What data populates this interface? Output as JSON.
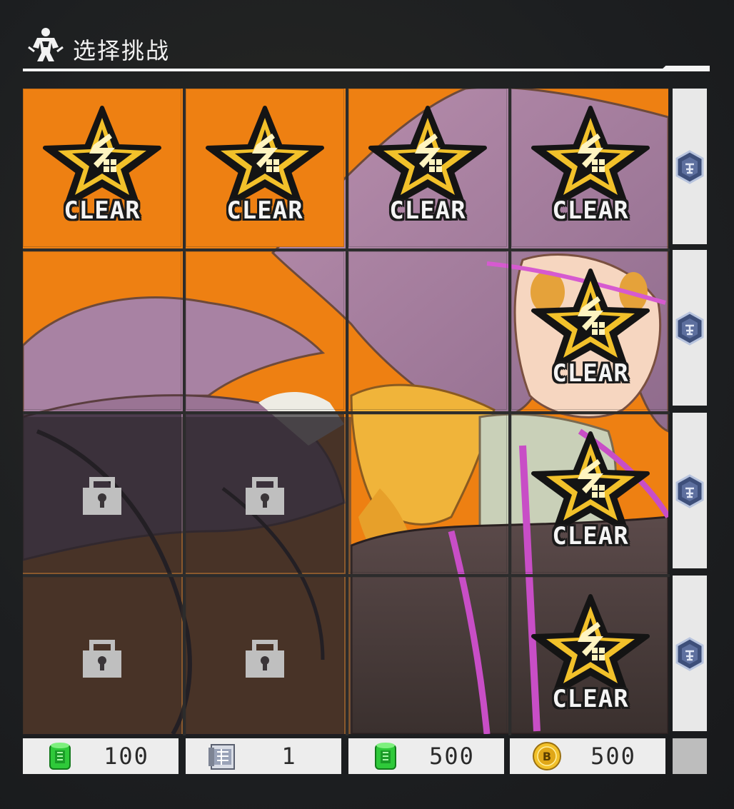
{
  "header": {
    "title": "选择挑战",
    "icon": "warrior-silhouette-icon"
  },
  "board": {
    "rows": 4,
    "cols": 4,
    "cells": [
      {
        "row": 1,
        "col": 1,
        "state": "clear",
        "revealed": false
      },
      {
        "row": 1,
        "col": 2,
        "state": "clear",
        "revealed": false
      },
      {
        "row": 1,
        "col": 3,
        "state": "clear",
        "revealed": true
      },
      {
        "row": 1,
        "col": 4,
        "state": "clear",
        "revealed": true
      },
      {
        "row": 2,
        "col": 1,
        "state": "open",
        "revealed": true
      },
      {
        "row": 2,
        "col": 2,
        "state": "open",
        "revealed": true
      },
      {
        "row": 2,
        "col": 3,
        "state": "open",
        "revealed": true
      },
      {
        "row": 2,
        "col": 4,
        "state": "clear",
        "revealed": true
      },
      {
        "row": 3,
        "col": 1,
        "state": "locked",
        "revealed": true
      },
      {
        "row": 3,
        "col": 2,
        "state": "locked",
        "revealed": true
      },
      {
        "row": 3,
        "col": 3,
        "state": "open",
        "revealed": true
      },
      {
        "row": 3,
        "col": 4,
        "state": "clear",
        "revealed": true
      },
      {
        "row": 4,
        "col": 1,
        "state": "locked",
        "revealed": true
      },
      {
        "row": 4,
        "col": 2,
        "state": "locked",
        "revealed": true
      },
      {
        "row": 4,
        "col": 3,
        "state": "open",
        "revealed": true
      },
      {
        "row": 4,
        "col": 4,
        "state": "clear",
        "revealed": true
      }
    ],
    "clear_label": "CLEAR"
  },
  "row_rewards": [
    {
      "icon": "medal-icon"
    },
    {
      "icon": "medal-icon"
    },
    {
      "icon": "medal-icon"
    },
    {
      "icon": "medal-icon"
    }
  ],
  "column_rewards": [
    {
      "icon": "green-fuel-can-icon",
      "value": "100"
    },
    {
      "icon": "blueprint-document-icon",
      "value": "1"
    },
    {
      "icon": "green-fuel-can-icon",
      "value": "500"
    },
    {
      "icon": "gold-coin-icon",
      "value": "500"
    }
  ],
  "colors": {
    "hidden_tile": "#ee8012",
    "accent_gold": "#f2c12a"
  }
}
